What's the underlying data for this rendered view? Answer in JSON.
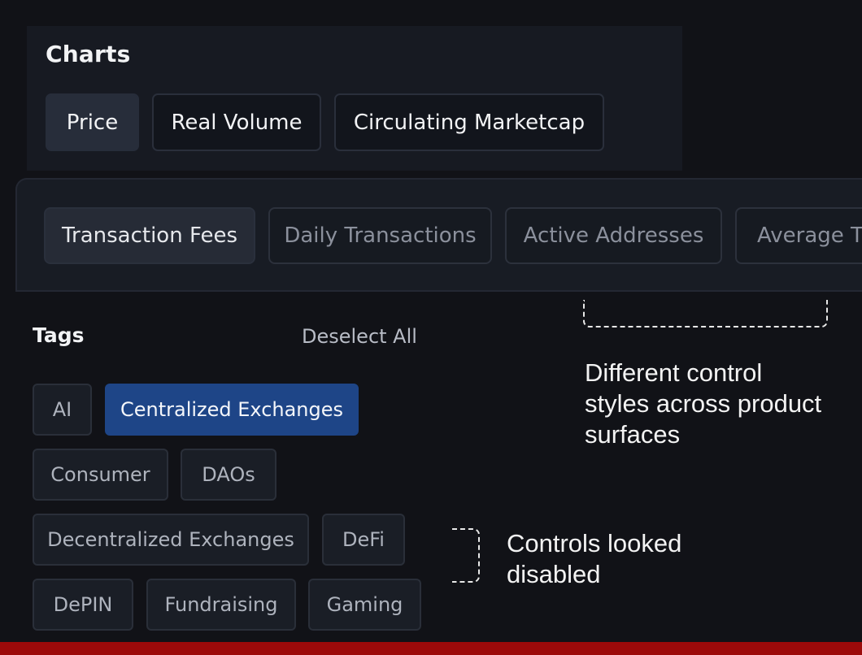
{
  "charts": {
    "title": "Charts",
    "tabs": [
      {
        "label": "Price",
        "active": true
      },
      {
        "label": "Real Volume",
        "active": false
      },
      {
        "label": "Circulating Marketcap",
        "active": false
      }
    ]
  },
  "metrics": {
    "tabs": [
      {
        "label": "Transaction Fees",
        "active": true
      },
      {
        "label": "Daily Transactions",
        "active": false
      },
      {
        "label": "Active Addresses",
        "active": false
      },
      {
        "label": "Average Tr",
        "active": false
      }
    ]
  },
  "tags": {
    "title": "Tags",
    "deselect_label": "Deselect All",
    "items": [
      {
        "label": "AI",
        "selected": false
      },
      {
        "label": "Centralized Exchanges",
        "selected": true
      },
      {
        "label": "Consumer",
        "selected": false
      },
      {
        "label": "DAOs",
        "selected": false
      },
      {
        "label": "Decentralized Exchanges",
        "selected": false
      },
      {
        "label": "DeFi",
        "selected": false
      },
      {
        "label": "DePIN",
        "selected": false
      },
      {
        "label": "Fundraising",
        "selected": false
      },
      {
        "label": "Gaming",
        "selected": false
      }
    ]
  },
  "annotations": {
    "control_styles": "Different control styles across product surfaces",
    "disabled": "Controls looked disabled"
  },
  "colors": {
    "background": "#111217",
    "selected_tag": "#1e4587",
    "accent_bar": "#9c0a0a"
  }
}
